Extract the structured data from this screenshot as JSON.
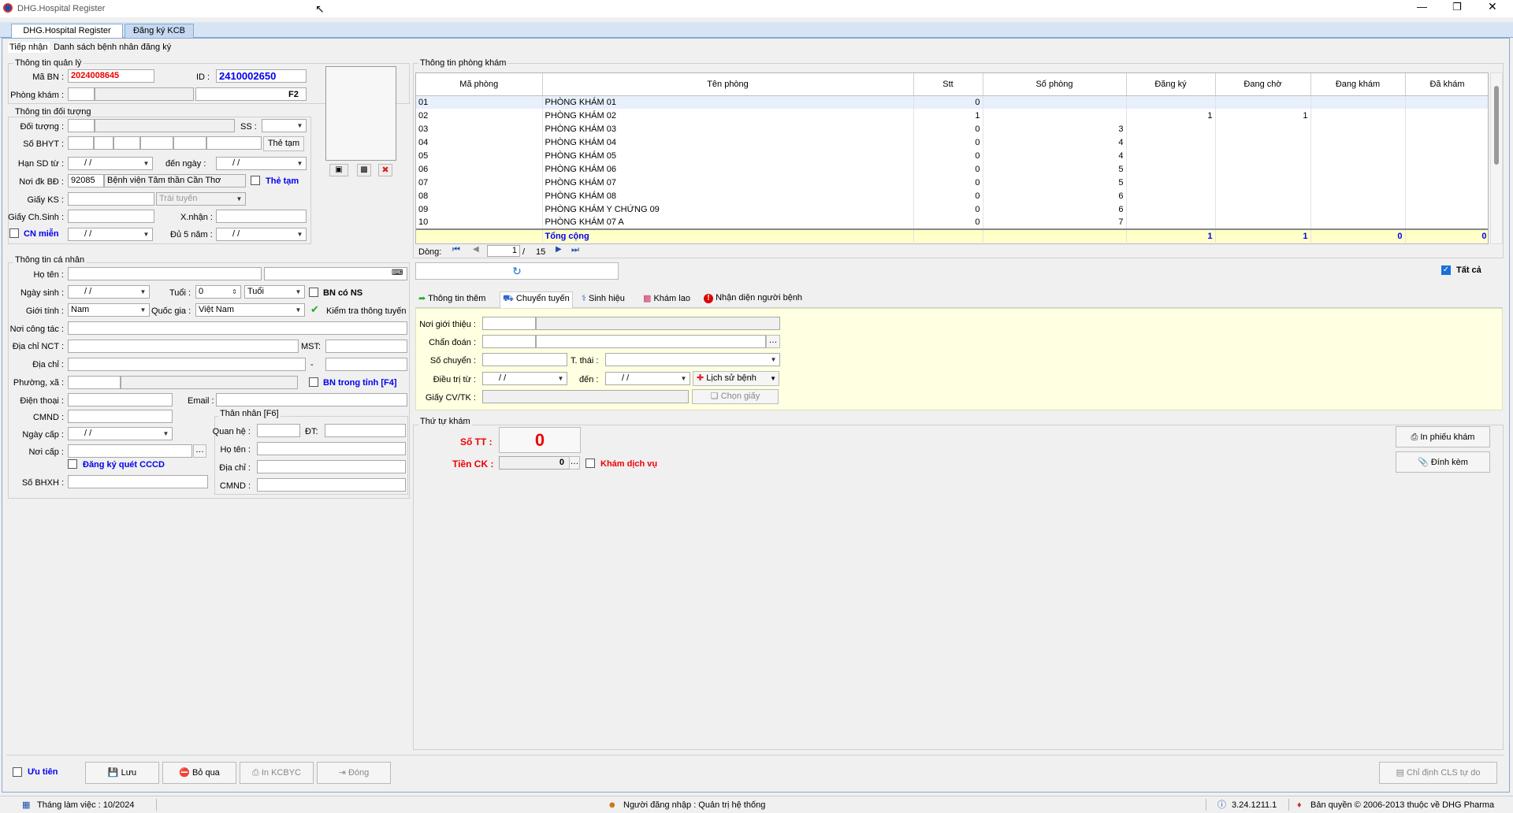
{
  "window": {
    "title": "DHG.Hospital Register"
  },
  "tabs": [
    "DHG.Hospital Register",
    "Đăng ký KCB"
  ],
  "subtabs": [
    "Tiếp nhận",
    "Danh sách bệnh nhân đăng ký"
  ],
  "qly": {
    "title": "Thông tin quản lý",
    "ma_bn_label": "Mã BN :",
    "ma_bn": "2024008645",
    "id_label": "ID :",
    "id": "2410002650",
    "phong_kham_label": "Phòng khám :",
    "f2": "F2"
  },
  "dt": {
    "title": "Thông tin đối tượng",
    "doi_tuong_label": "Đối tượng :",
    "ss_label": "SS :",
    "so_bhyt_label": "Số BHYT :",
    "the_tam_btn": "Thẻ tạm",
    "han_sd_label": "Hạn SD từ :",
    "den_ngay_label": "đến ngày :",
    "date_blank": "/ /",
    "noi_dk_label": "Nơi đk BĐ :",
    "noi_dk_code": "92085",
    "noi_dk_name": "Bệnh viện Tâm thần Cần Thơ",
    "the_tam_chk": "Thẻ tạm",
    "giay_ks_label": "Giấy KS :",
    "trai_tuyen": "Trái tuyến",
    "giay_chsinh_label": "Giấy Ch.Sinh :",
    "xnhan_label": "X.nhận :",
    "cn_mien": "CN miễn",
    "du5nam_label": "Đủ 5 năm :"
  },
  "cn": {
    "title": "Thông tin cá nhân",
    "ho_ten_label": "Họ tên :",
    "ngay_sinh_label": "Ngày sinh :",
    "tuoi_label": "Tuổi :",
    "tuoi": "0",
    "tuoi_unit": "Tuổi",
    "bn_co_ns": "BN có NS",
    "gioi_tinh_label": "Giới tính :",
    "gioi_tinh": "Nam",
    "quoc_gia_label": "Quốc gia :",
    "quoc_gia": "Việt Nam",
    "kiem_tra": "Kiểm tra thông tuyến",
    "noi_cong_tac_label": "Nơi công tác :",
    "dia_chi_nct_label": "Địa chỉ NCT :",
    "mst_label": "MST:",
    "dia_chi_label": "Địa chỉ :",
    "dash": "-",
    "phuong_xa_label": "Phường, xã :",
    "bn_trong_tinh": "BN trong tỉnh [F4]",
    "dien_thoai_label": "Điện thoại :",
    "email_label": "Email :",
    "cmnd_label": "CMND :",
    "ngay_cap_label": "Ngày cấp :",
    "noi_cap_label": "Nơi cấp :",
    "dang_ky_cccd": "Đăng ký quét CCCD",
    "so_bhxh_label": "Số BHXH :",
    "than_nhan": {
      "title": "Thân nhân [F6]",
      "quan_he_label": "Quan hệ :",
      "dt_label": "ĐT:",
      "ho_ten_label": "Họ tên :",
      "dia_chi_label": "Địa chỉ :",
      "cmnd_label": "CMND :"
    }
  },
  "pk": {
    "title": "Thông tin phòng khám",
    "cols": [
      "Mã phòng",
      "Tên phòng",
      "Stt",
      "Số phòng",
      "Đăng ký",
      "Đang chờ",
      "Đang khám",
      "Đã khám"
    ],
    "rows": [
      [
        "01",
        "PHÒNG KHÁM 01",
        "0",
        "",
        "",
        "",
        "",
        ""
      ],
      [
        "02",
        "PHÒNG KHÁM 02",
        "1",
        "",
        "1",
        "1",
        "",
        ""
      ],
      [
        "03",
        "PHÒNG KHÁM 03",
        "0",
        "3",
        "",
        "",
        "",
        ""
      ],
      [
        "04",
        "PHÒNG KHÁM 04",
        "0",
        "4",
        "",
        "",
        "",
        ""
      ],
      [
        "05",
        "PHÒNG KHÁM 05",
        "0",
        "4",
        "",
        "",
        "",
        ""
      ],
      [
        "06",
        "PHÒNG KHÁM 06",
        "0",
        "5",
        "",
        "",
        "",
        ""
      ],
      [
        "07",
        "PHÒNG KHÁM 07",
        "0",
        "5",
        "",
        "",
        "",
        ""
      ],
      [
        "08",
        "PHÒNG KHÁM 08",
        "0",
        "6",
        "",
        "",
        "",
        ""
      ],
      [
        "09",
        "PHÒNG KHÁM Y CHỨNG 09",
        "0",
        "6",
        "",
        "",
        "",
        ""
      ],
      [
        "10",
        "PHÒNG KHÁM 07 A",
        "0",
        "7",
        "",
        "",
        "",
        ""
      ]
    ],
    "total_label": "Tổng cộng",
    "total": [
      "1",
      "1",
      "0",
      "0"
    ],
    "dong_label": "Dòng:",
    "page": "1",
    "pages": "15",
    "tat_ca": "Tất cả"
  },
  "detail_tabs": [
    "Thông tin thêm",
    "Chuyển tuyến",
    "Sinh hiệu",
    "Khám lao",
    "Nhận diện người bệnh"
  ],
  "ct": {
    "noi_gioi_thieu": "Nơi giới thiệu :",
    "chan_doan": "Chẩn đoán :",
    "so_chuyen": "Số chuyển :",
    "t_thai": "T. thái :",
    "dieu_tri_tu": "Điều trị từ :",
    "den": "đến :",
    "lich_su": "Lịch sử bệnh",
    "giay_cv": "Giấy CV/TK :",
    "chon_giay": "Chọn giấy"
  },
  "ttk": {
    "title": "Thứ tự khám",
    "so_tt_label": "Số TT :",
    "so_tt": "0",
    "tien_ck_label": "Tiền CK :",
    "tien_ck": "0",
    "kham_dv": "Khám dịch vụ",
    "in_phieu": "In phiếu khám",
    "dinh_kem": "Đính kèm"
  },
  "bottom": {
    "uu_tien": "Ưu tiên",
    "luu": "Lưu",
    "bo_qua": "Bỏ qua",
    "in_kcbyc": "In KCBYC",
    "dong": "Đóng",
    "chi_dinh": "Chỉ định CLS tự do"
  },
  "status": {
    "thang": "Tháng làm việc : 10/2024",
    "nguoi": "Người đăng nhập : Quản trị hệ thống",
    "version": "3.24.1211.1",
    "copyright": "Bản quyền © 2006-2013 thuộc về DHG Pharma"
  }
}
